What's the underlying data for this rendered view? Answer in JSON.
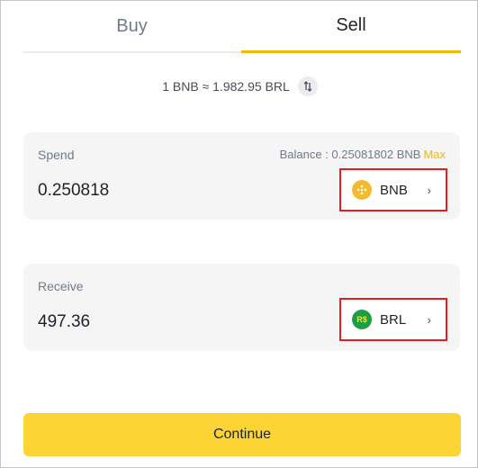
{
  "tabs": [
    {
      "label": "Buy",
      "active": false
    },
    {
      "label": "Sell",
      "active": true
    }
  ],
  "rate": {
    "text": "1 BNB ≈ 1.982.95 BRL",
    "swap_icon": "swap-vertical-icon"
  },
  "spend": {
    "label": "Spend",
    "balance_text": "Balance : 0.25081802 BNB",
    "max_label": "Max",
    "amount": "0.250818",
    "currency": {
      "code": "BNB",
      "icon": "bnb-coin-icon",
      "chevron": "›"
    }
  },
  "receive": {
    "label": "Receive",
    "amount": "497.36",
    "currency": {
      "code": "BRL",
      "icon_text": "R$",
      "icon": "brl-coin-icon",
      "chevron": "›"
    }
  },
  "continue_label": "Continue",
  "colors": {
    "accent": "#f0b90b",
    "button": "#fcd535",
    "highlight_border": "#e02020",
    "card_bg": "#f5f5f5"
  }
}
